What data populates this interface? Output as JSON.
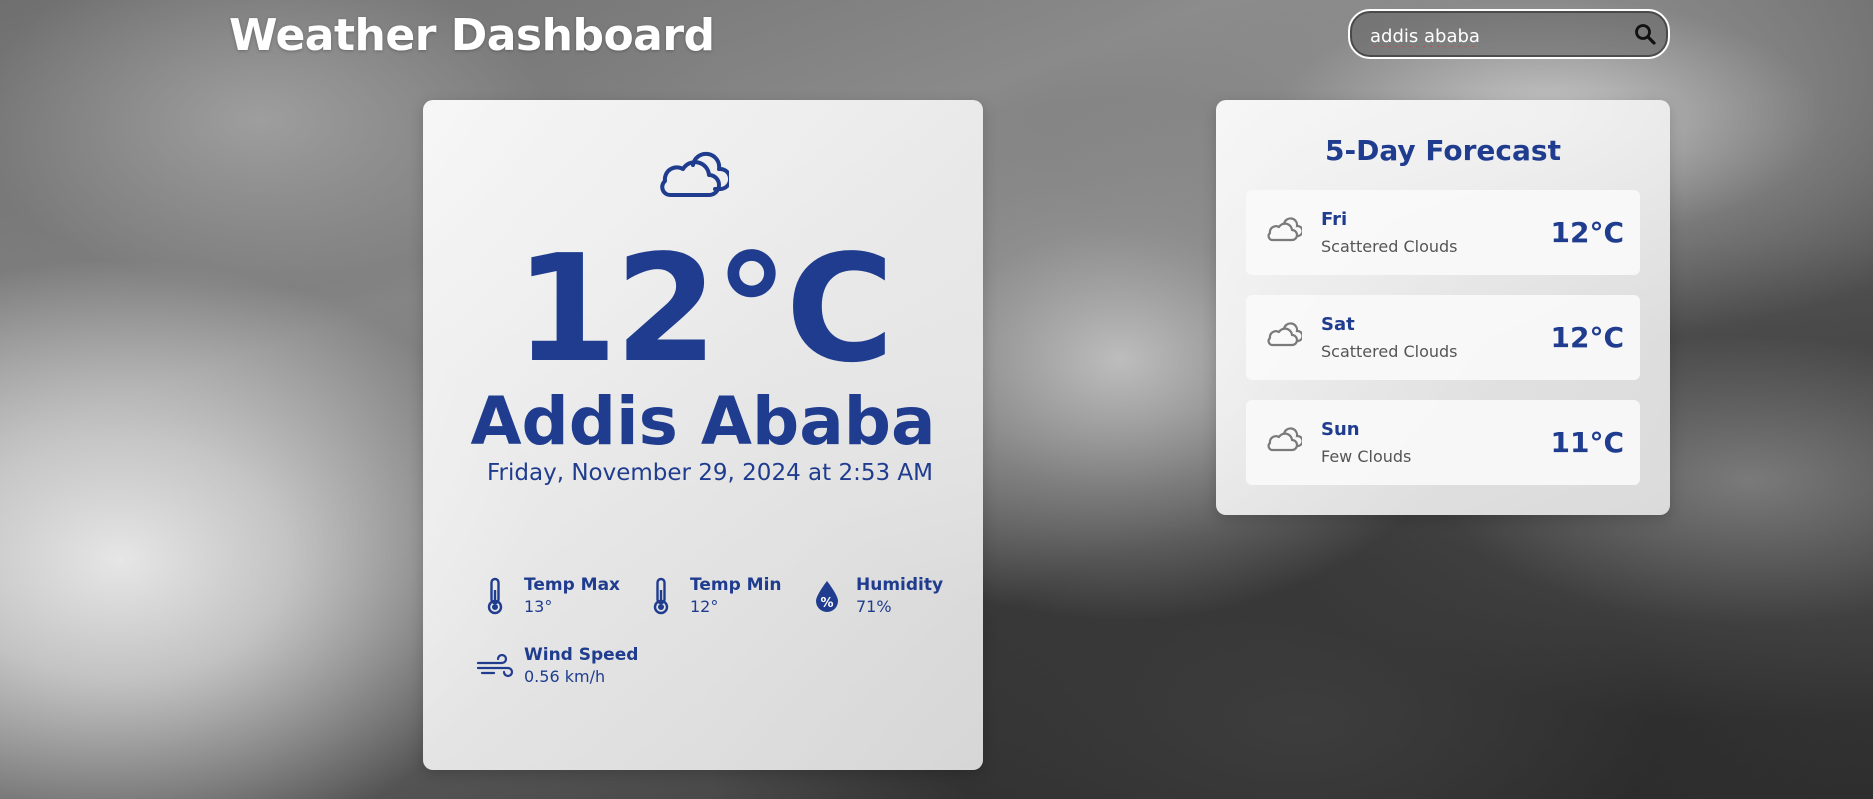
{
  "header": {
    "title": "Weather Dashboard"
  },
  "search": {
    "value": "addis ababa",
    "icon": "search-icon"
  },
  "current": {
    "icon": "cloud-icon",
    "temperature": "12°C",
    "city": "Addis Ababa",
    "datetime": "Friday, November 29, 2024 at 2:53 AM",
    "details": [
      {
        "label": "Temp Max",
        "value": "13°",
        "icon": "thermometer-icon"
      },
      {
        "label": "Temp Min",
        "value": "12°",
        "icon": "thermometer-icon"
      },
      {
        "label": "Humidity",
        "value": "71%",
        "icon": "humidity-icon"
      },
      {
        "label": "Wind Speed",
        "value": "0.56 km/h",
        "icon": "wind-icon"
      }
    ]
  },
  "forecast": {
    "title": "5-Day Forecast",
    "days": [
      {
        "day": "Fri",
        "description": "Scattered Clouds",
        "temp": "12°C",
        "icon": "cloud-icon"
      },
      {
        "day": "Sat",
        "description": "Scattered Clouds",
        "temp": "12°C",
        "icon": "cloud-icon"
      },
      {
        "day": "Sun",
        "description": "Few Clouds",
        "temp": "11°C",
        "icon": "cloud-icon"
      }
    ]
  },
  "colors": {
    "accent": "#1f3c8f",
    "forecast_icon": "#7a7a7a"
  }
}
